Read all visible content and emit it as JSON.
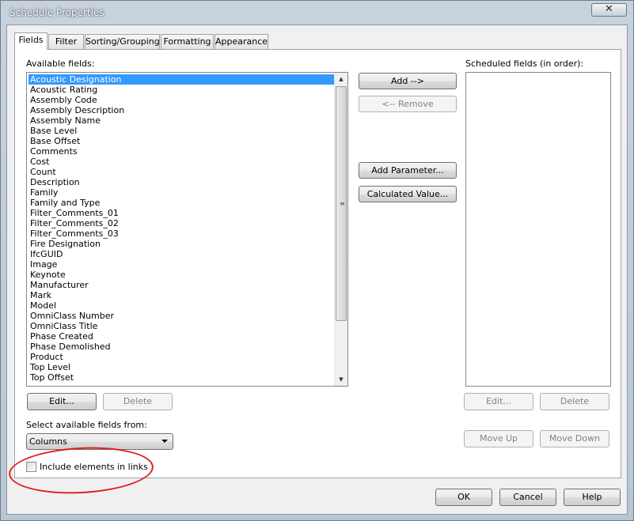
{
  "window": {
    "title": "Schedule Properties",
    "close_glyph": "✕"
  },
  "tabs": [
    {
      "label": "Fields",
      "active": true
    },
    {
      "label": "Filter"
    },
    {
      "label": "Sorting/Grouping"
    },
    {
      "label": "Formatting"
    },
    {
      "label": "Appearance"
    }
  ],
  "available": {
    "label": "Available fields:",
    "items": [
      "Acoustic Designation",
      "Acoustic Rating",
      "Assembly Code",
      "Assembly Description",
      "Assembly Name",
      "Base Level",
      "Base Offset",
      "Comments",
      "Cost",
      "Count",
      "Description",
      "Family",
      "Family and Type",
      "Filter_Comments_01",
      "Filter_Comments_02",
      "Filter_Comments_03",
      "Fire Designation",
      "IfcGUID",
      "Image",
      "Keynote",
      "Manufacturer",
      "Mark",
      "Model",
      "OmniClass Number",
      "OmniClass Title",
      "Phase Created",
      "Phase Demolished",
      "Product",
      "Top Level",
      "Top Offset"
    ],
    "selected_index": 0,
    "edit_label": "Edit...",
    "delete_label": "Delete"
  },
  "middle": {
    "add_label": "Add -->",
    "remove_label": "<-- Remove",
    "add_parameter_label": "Add Parameter...",
    "calculated_value_label": "Calculated Value..."
  },
  "scheduled": {
    "label": "Scheduled fields (in order):",
    "edit_label": "Edit...",
    "delete_label": "Delete",
    "move_up_label": "Move Up",
    "move_down_label": "Move Down"
  },
  "source": {
    "label": "Select available fields from:",
    "selected": "Columns"
  },
  "include_links": {
    "label": "Include elements in links",
    "checked": false
  },
  "footer": {
    "ok_label": "OK",
    "cancel_label": "Cancel",
    "help_label": "Help"
  },
  "colors": {
    "selection": "#3399ff",
    "annotation": "#e02020"
  }
}
